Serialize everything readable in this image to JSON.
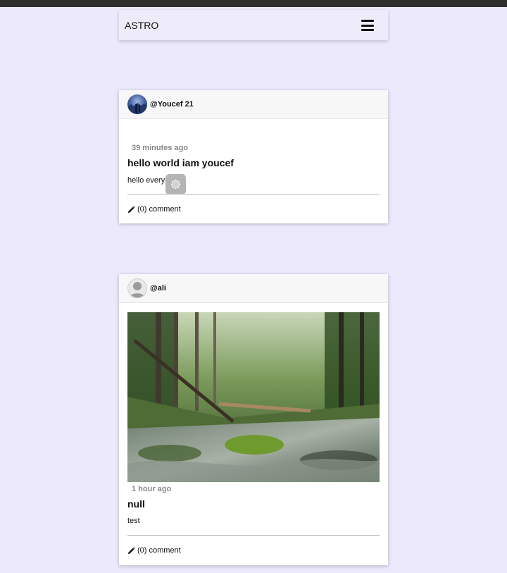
{
  "app": {
    "brand": "ASTRO"
  },
  "posts": [
    {
      "username": "@Youcef 21",
      "time": "39 minutes ago",
      "title": "hello world iam youcef",
      "body": "hello everyone",
      "comments": "(0) comment",
      "has_image": false
    },
    {
      "username": "@ali",
      "time": "1 hour ago",
      "title": "null",
      "body": "test",
      "comments": "(0) comment",
      "has_image": true
    }
  ],
  "icons": {
    "menu": "hamburger-icon",
    "edit": "pencil-icon",
    "settings": "gear-icon"
  },
  "colors": {
    "page_bg": "#ebe9fb",
    "topbar": "#2f2f2f",
    "time_text": "#888888"
  }
}
